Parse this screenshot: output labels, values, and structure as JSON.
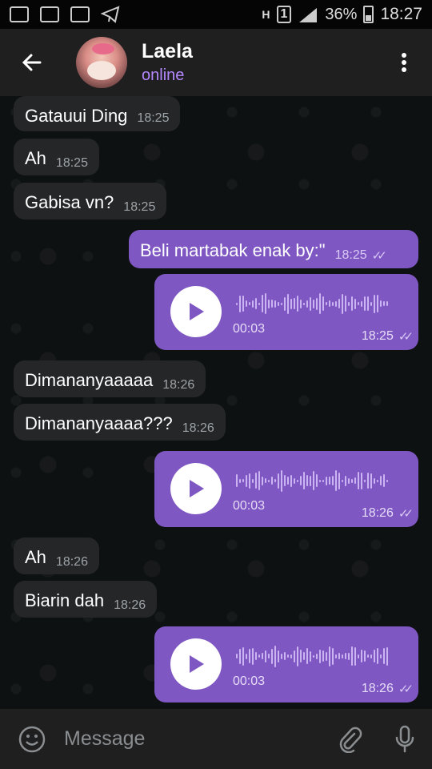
{
  "status_bar": {
    "battery": "36%",
    "time": "18:27",
    "sim": "1",
    "network": "H"
  },
  "header": {
    "name": "Laela",
    "status": "online"
  },
  "messages": [
    {
      "dir": "in",
      "text": "Gatauui Ding",
      "time": "18:25"
    },
    {
      "dir": "in",
      "text": "Ah",
      "time": "18:25"
    },
    {
      "dir": "in",
      "text": "Gabisa vn?",
      "time": "18:25"
    },
    {
      "dir": "out",
      "text": "Beli martabak enak by:\"",
      "time": "18:25"
    },
    {
      "dir": "out",
      "type": "voice",
      "duration": "00:03",
      "time": "18:25"
    },
    {
      "dir": "in",
      "text": "Dimananyaaaaa",
      "time": "18:26"
    },
    {
      "dir": "in",
      "text": "Dimananyaaaa???",
      "time": "18:26"
    },
    {
      "dir": "out",
      "type": "voice",
      "duration": "00:03",
      "time": "18:26"
    },
    {
      "dir": "in",
      "text": "Ah",
      "time": "18:26"
    },
    {
      "dir": "in",
      "text": "Biarin dah",
      "time": "18:26"
    },
    {
      "dir": "out",
      "type": "voice",
      "duration": "00:03",
      "time": "18:26"
    }
  ],
  "input": {
    "placeholder": "Message"
  },
  "colors": {
    "accent": "#7e57c2",
    "status_online": "#b388ff",
    "header_bg": "#1f1f1f",
    "incoming_bg": "#242628"
  },
  "icons": [
    "back-arrow-icon",
    "more-vert-icon",
    "play-icon",
    "emoji-icon",
    "paperclip-icon",
    "mic-icon",
    "double-check-icon"
  ]
}
